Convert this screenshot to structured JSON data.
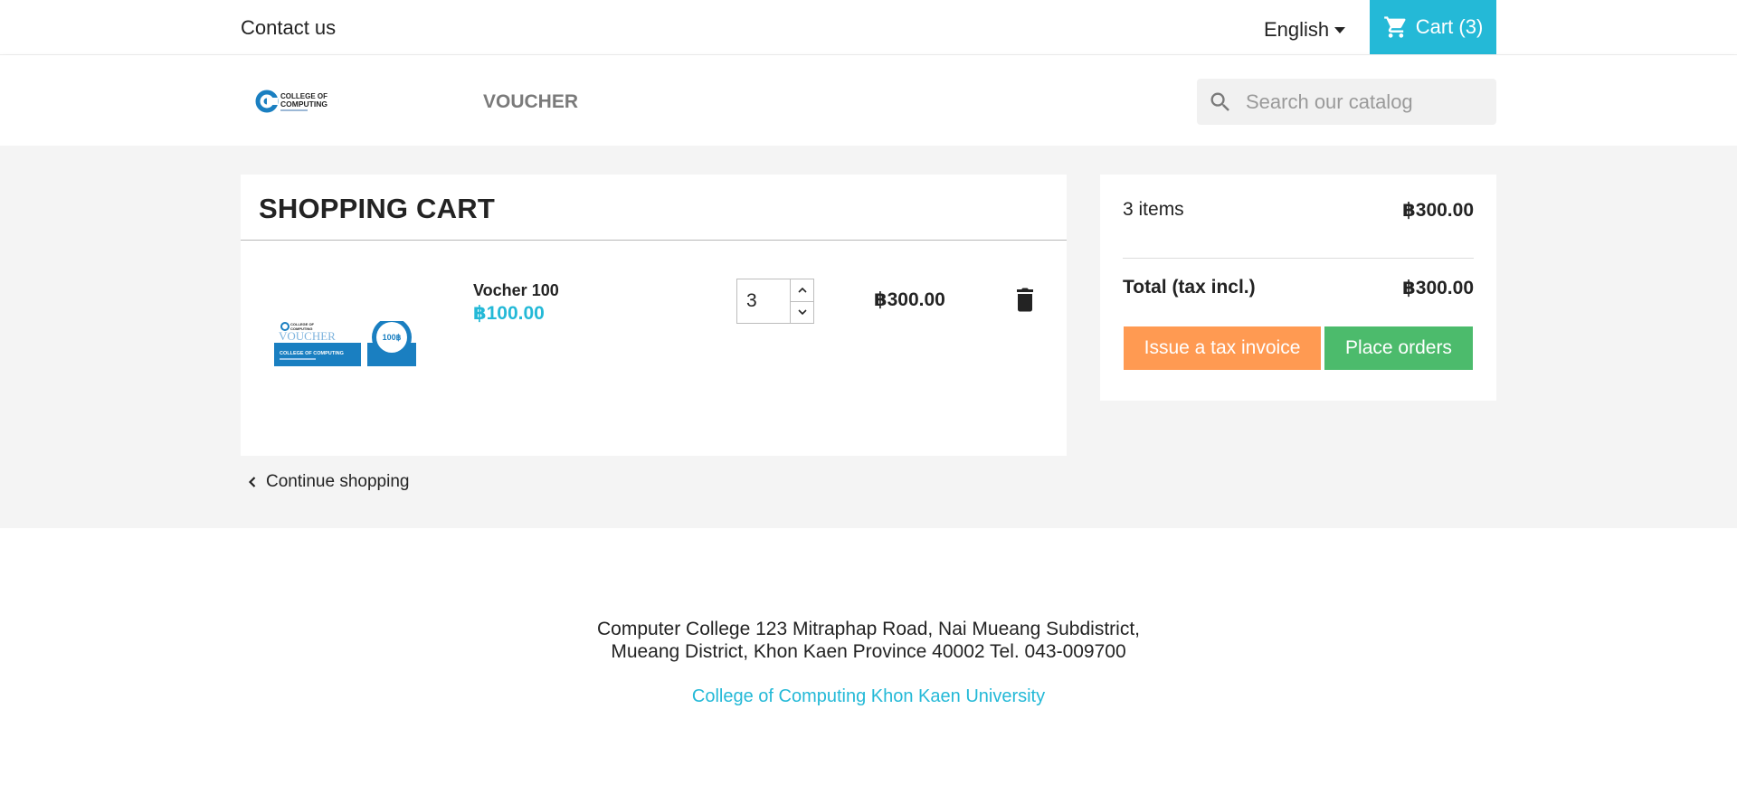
{
  "topbar": {
    "contact_label": "Contact us",
    "language_label": "English",
    "cart_label": "Cart (3)"
  },
  "header": {
    "logo_text_line1": "COLLEGE OF",
    "logo_text_line2": "COMPUTING",
    "nav_voucher": "VOUCHER",
    "search_placeholder": "Search our catalog"
  },
  "cart": {
    "title": "SHOPPING CART",
    "items": [
      {
        "name": "Vocher 100",
        "unit_price": "฿100.00",
        "quantity": "3",
        "line_total": "฿300.00",
        "image": {
          "header_line1": "COLLEGE OF",
          "header_line2": "COMPUTING",
          "word": "VOUCHER",
          "banner": "COLLEGE OF COMPUTING",
          "badge": "100฿"
        }
      }
    ],
    "continue_label": "Continue shopping"
  },
  "summary": {
    "items_label": "3 items",
    "items_value": "฿300.00",
    "total_label": "Total (tax incl.)",
    "total_value": "฿300.00",
    "invoice_button": "Issue a tax invoice",
    "order_button": "Place orders"
  },
  "footer": {
    "address_line1": "Computer College 123 Mitraphap Road, Nai Mueang Subdistrict,",
    "address_line2": "Mueang District, Khon Kaen Province 40002 Tel. 043-009700",
    "link": "College of Computing Khon Kaen University"
  },
  "colors": {
    "accent": "#24b9d7",
    "invoice_button": "#ff9a52",
    "order_button": "#4cbb6c",
    "page_bg": "#f4f4f4"
  },
  "icons": {
    "cart": "shopping-cart-icon",
    "search": "search-icon",
    "language_caret": "caret-down-icon",
    "delete": "trash-icon",
    "back": "chevron-left-icon",
    "qty_up": "chevron-up-icon",
    "qty_down": "chevron-down-icon"
  }
}
